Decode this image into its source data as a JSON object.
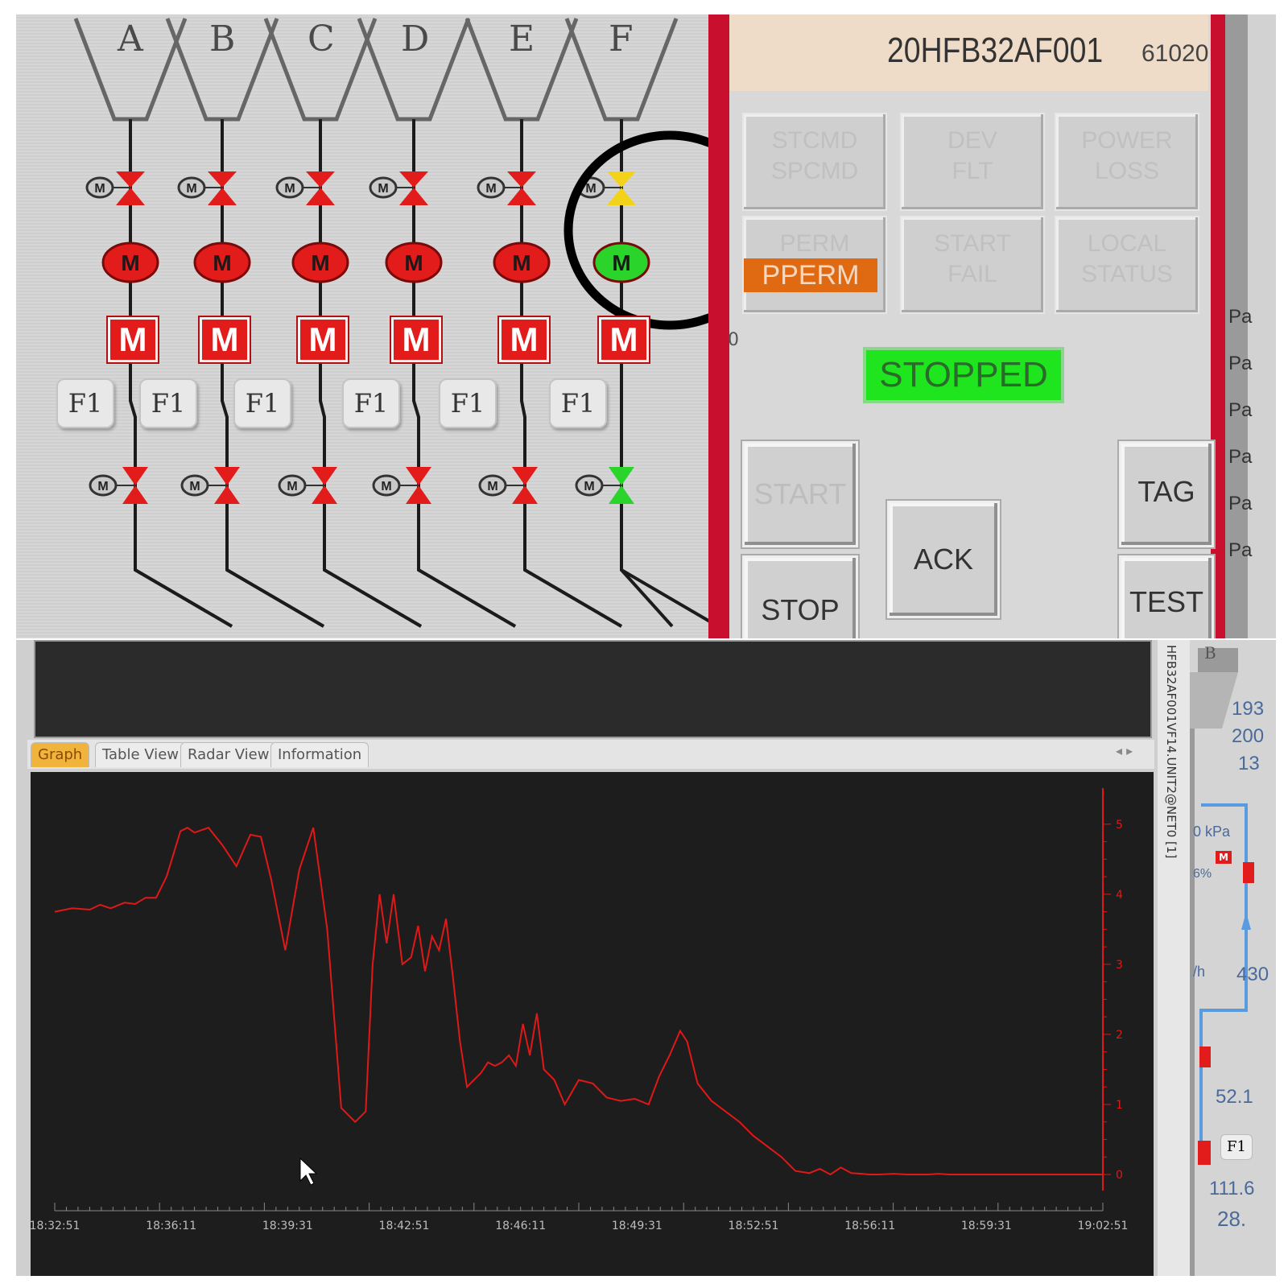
{
  "mimic": {
    "hoppers": [
      "A",
      "B",
      "C",
      "D",
      "E",
      "F"
    ],
    "mode_label": "M",
    "motor_label": "M",
    "valve_motor_label": "M",
    "feeder_label": "F1",
    "valve_states": [
      "red",
      "red",
      "red",
      "red",
      "red",
      "yellow"
    ],
    "motor_states": [
      "red",
      "red",
      "red",
      "red",
      "red",
      "green"
    ],
    "lower_valve_states": [
      "red",
      "red",
      "red",
      "red",
      "red",
      "green"
    ]
  },
  "faceplate": {
    "tag": "20HFB32AF001",
    "tag_number": "61020",
    "status_cells": [
      [
        "STCMD",
        "SPCMD"
      ],
      [
        "DEV",
        "FLT"
      ],
      [
        "POWER",
        "LOSS"
      ],
      [
        "PERM",
        ""
      ],
      [
        "START",
        "FAIL"
      ],
      [
        "LOCAL",
        "STATUS"
      ]
    ],
    "pperm_label": "PPERM",
    "zero_mark": "0",
    "status": "STOPPED",
    "buttons": {
      "start": "START",
      "stop": "STOP",
      "ack": "ACK",
      "tag": "TAG",
      "test": "TEST"
    },
    "right_edge_labels": [
      "Pa",
      "Pa",
      "Pa",
      "Pa",
      "Pa",
      "Pa"
    ],
    "colors": {
      "frame": "#c8102e",
      "status_ok": "#1ee51e",
      "pperm": "#e06a12"
    }
  },
  "trend": {
    "tabs": [
      "Graph",
      "Table View",
      "Radar View",
      "Information"
    ],
    "active_tab": "Graph",
    "vertical_tag": "HFB32AF001VF14.UNIT2@NET0 [1]",
    "line_color": "#e01818"
  },
  "chart_data": {
    "type": "line",
    "x_ticks": [
      "18:32:51",
      "18:36:11",
      "18:39:31",
      "18:42:51",
      "18:46:11",
      "18:49:31",
      "18:52:51",
      "18:56:11",
      "18:59:31",
      "19:02:51"
    ],
    "y_ticks": [
      "0",
      "1",
      "2",
      "3",
      "4",
      "5"
    ],
    "ylim": [
      0,
      5.4
    ],
    "series": [
      {
        "x_minutes": [
          0,
          0.5,
          1,
          1.3,
          1.6,
          2,
          2.3,
          2.6,
          2.9,
          3.2,
          3.6,
          3.8,
          4,
          4.4,
          4.8,
          5.2,
          5.6,
          5.9,
          6.2,
          6.6,
          7,
          7.4,
          7.8,
          8.2,
          8.6,
          8.9,
          9.1,
          9.3,
          9.5,
          9.7,
          9.95,
          10.2,
          10.4,
          10.6,
          10.8,
          11,
          11.2,
          11.4,
          11.6,
          11.8,
          12.0,
          12.2,
          12.4,
          12.6,
          12.8,
          13.0,
          13.2,
          13.4,
          13.6,
          13.8,
          14.0,
          14.3,
          14.6,
          15,
          15.4,
          15.8,
          16.2,
          16.6,
          17,
          17.3,
          17.6,
          17.9,
          18.1,
          18.4,
          18.8,
          19.2,
          19.6,
          20,
          20.4,
          20.8,
          21.2,
          21.6,
          21.9,
          22.2,
          22.5,
          22.8,
          23.1,
          23.3,
          23.6,
          24,
          24.4,
          24.8,
          25,
          25.3,
          25.6,
          26,
          26.5,
          27,
          28,
          29,
          30
        ],
        "values": [
          3.75,
          3.8,
          3.78,
          3.85,
          3.8,
          3.88,
          3.86,
          3.95,
          3.95,
          4.25,
          4.9,
          4.95,
          4.88,
          4.95,
          4.7,
          4.4,
          4.85,
          4.82,
          4.2,
          3.2,
          4.35,
          4.95,
          3.5,
          0.95,
          0.75,
          0.9,
          3.0,
          4.0,
          3.3,
          4.0,
          3.0,
          3.1,
          3.55,
          2.9,
          3.4,
          3.2,
          3.65,
          2.8,
          1.9,
          1.25,
          1.35,
          1.45,
          1.6,
          1.55,
          1.6,
          1.7,
          1.55,
          2.15,
          1.7,
          2.3,
          1.5,
          1.35,
          1.0,
          1.35,
          1.3,
          1.1,
          1.05,
          1.08,
          1.0,
          1.4,
          1.7,
          2.05,
          1.9,
          1.3,
          1.05,
          0.9,
          0.75,
          0.55,
          0.4,
          0.25,
          0.05,
          0.02,
          0.08,
          0.0,
          0.1,
          0.02,
          0.01,
          0.0,
          0.0,
          0.01,
          0.0,
          0.0,
          0.0,
          0.01,
          0.0,
          0.0,
          0.0,
          0.0,
          0.0,
          0.0,
          0.0
        ]
      }
    ],
    "title": "",
    "xlabel": "",
    "ylabel": "",
    "grid": false
  },
  "side_panel": {
    "values": [
      "193",
      "200",
      "13",
      "0 kPa",
      "6%",
      "/h",
      "430",
      "52.1",
      "111.6",
      "28."
    ],
    "hopper_label": "B",
    "feeder_label": "F1",
    "motor_label": "M"
  }
}
